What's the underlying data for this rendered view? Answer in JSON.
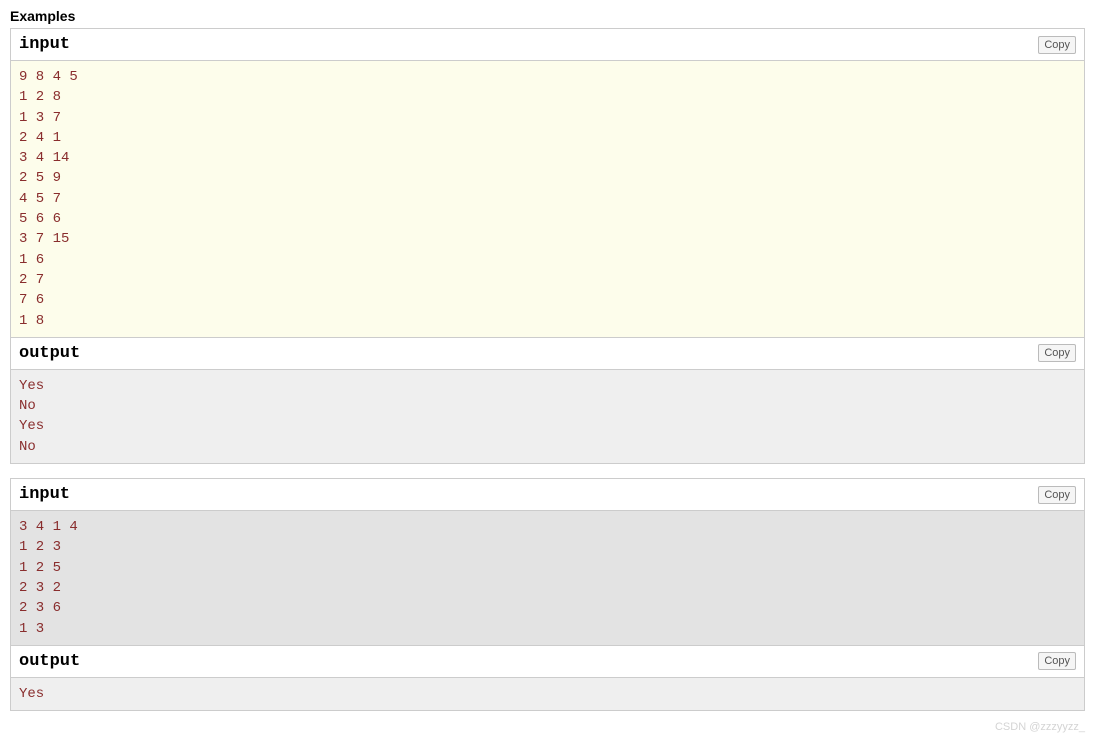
{
  "section_title": "Examples",
  "copy_label": "Copy",
  "examples": [
    {
      "sections": [
        {
          "type": "input",
          "title": "input",
          "content_class": "highlighted",
          "content": "9 8 4 5\n1 2 8\n1 3 7\n2 4 1\n3 4 14\n2 5 9\n4 5 7\n5 6 6\n3 7 15\n1 6\n2 7\n7 6\n1 8"
        },
        {
          "type": "output",
          "title": "output",
          "content_class": "grey",
          "content": "Yes\nNo\nYes\nNo"
        }
      ]
    },
    {
      "sections": [
        {
          "type": "input",
          "title": "input",
          "content_class": "darker-grey",
          "content": "3 4 1 4\n1 2 3\n1 2 5\n2 3 2\n2 3 6\n1 3"
        },
        {
          "type": "output",
          "title": "output",
          "content_class": "grey",
          "content": "Yes"
        }
      ]
    }
  ],
  "watermark": "CSDN @zzzyyzz_"
}
